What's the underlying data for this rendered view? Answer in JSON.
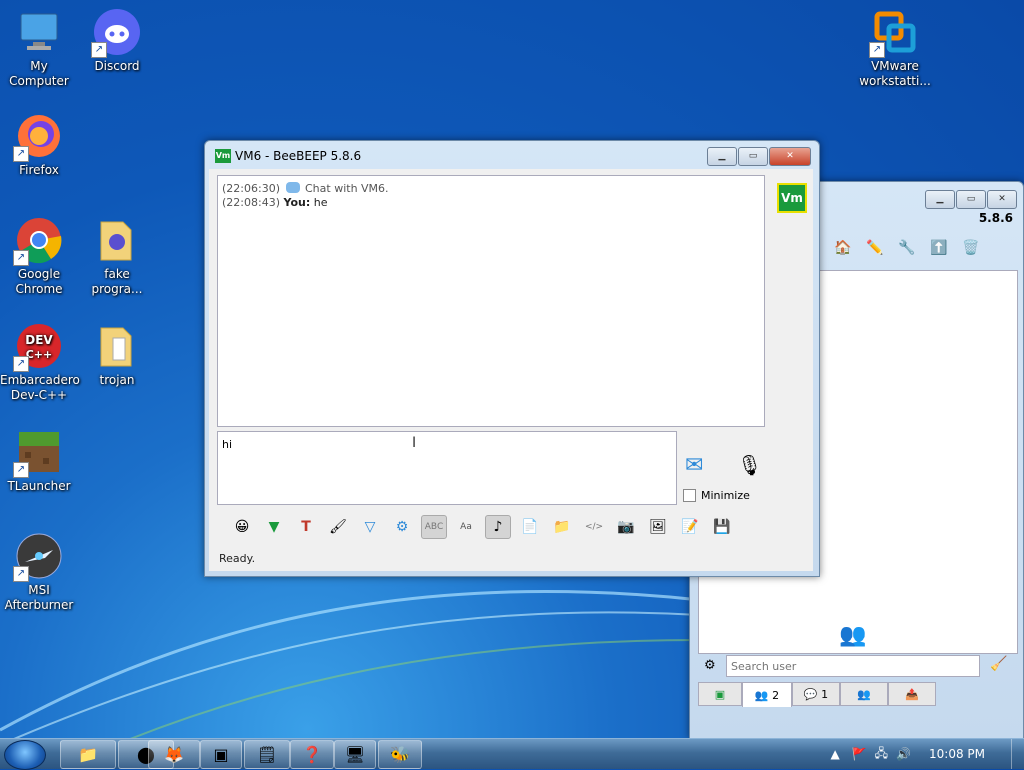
{
  "desktop": {
    "icons": [
      {
        "label": "My Computer"
      },
      {
        "label": "Discord"
      },
      {
        "label": "Firefox"
      },
      {
        "label": "Google Chrome"
      },
      {
        "label": "fake progra..."
      },
      {
        "label": "Embarcadero Dev-C++"
      },
      {
        "label": "trojan"
      },
      {
        "label": "TLauncher"
      },
      {
        "label": "MSI Afterburner"
      },
      {
        "label": "VMware workstatti..."
      }
    ]
  },
  "chat_window": {
    "title": "VM6 - BeeBEEP 5.8.6",
    "app_icon_text": "Vm",
    "avatar_text": "Vm",
    "messages": [
      {
        "time": "(22:06:30)",
        "author": "",
        "text": "Chat with VM6."
      },
      {
        "time": "(22:08:43)",
        "author": "You:",
        "text": "he"
      }
    ],
    "input_value": "hi",
    "minimize_label": "Minimize",
    "status": "Ready."
  },
  "main_window": {
    "version": "5.8.6",
    "search_placeholder": "Search user",
    "tabs": [
      {
        "label": ""
      },
      {
        "label": "2"
      },
      {
        "label": "1"
      },
      {
        "label": ""
      },
      {
        "label": ""
      }
    ]
  },
  "taskbar": {
    "clock": "10:08 PM"
  },
  "colors": {
    "accent": "#0e58b8",
    "beebeep_green": "#1a9a3c",
    "close_red": "#c8432a"
  }
}
